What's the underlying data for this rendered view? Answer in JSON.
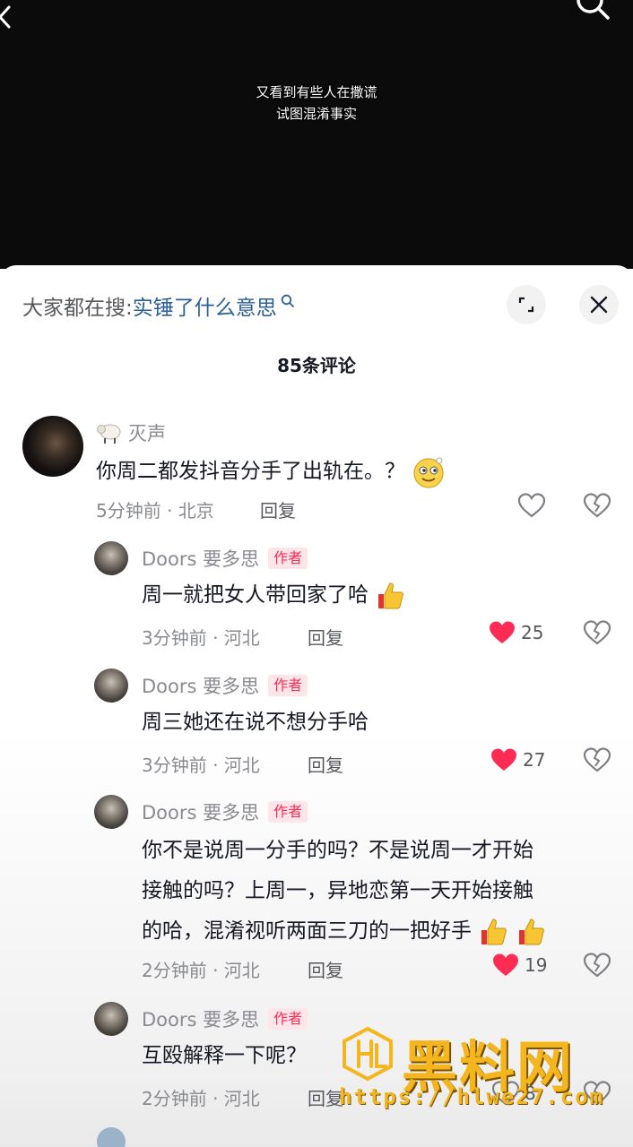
{
  "video": {
    "subtitle_line1": "又看到有些人在撒谎",
    "subtitle_line2": "试图混淆事实"
  },
  "search_bar": {
    "prefix": "大家都在搜:",
    "term": "实锤了什么意思"
  },
  "comment_count": "85条评论",
  "colors": {
    "like_red": "#fe2c55",
    "author_tag_text": "#fe2c55",
    "search_term": "#2b5f99",
    "watermark_gold": "#f5b51c"
  },
  "comments": [
    {
      "username": "灭声",
      "text": "你周二都发抖音分手了出轨在。？",
      "time_location": "5分钟前 · 北京",
      "reply_label": "回复",
      "liked": false,
      "like_count": ""
    },
    {
      "username": "Doors 要多思",
      "author_tag": "作者",
      "text": "周一就把女人带回家了哈",
      "time_location": "3分钟前 · 河北",
      "reply_label": "回复",
      "liked": true,
      "like_count": "25"
    },
    {
      "username": "Doors 要多思",
      "author_tag": "作者",
      "text": "周三她还在说不想分手哈",
      "time_location": "3分钟前 · 河北",
      "reply_label": "回复",
      "liked": true,
      "like_count": "27"
    },
    {
      "username": "Doors 要多思",
      "author_tag": "作者",
      "text_line1": "你不是说周一分手的吗？不是说周一才开始",
      "text_line2": "接触的吗？上周一，异地恋第一天开始接触",
      "text_line3": "的哈，混淆视听两面三刀的一把好手",
      "time_location": "2分钟前 · 河北",
      "reply_label": "回复",
      "liked": true,
      "like_count": "19"
    },
    {
      "username": "Doors 要多思",
      "author_tag": "作者",
      "text": "互殴解释一下呢？",
      "time_location": "2分钟前 · 河北",
      "reply_label": "回复",
      "liked": false,
      "like_count": "8"
    }
  ],
  "watermark": {
    "brand": "黑料网",
    "url": "https://hlwe27.com"
  },
  "icons": {
    "back": "back-arrow-icon",
    "search": "search-icon",
    "expand": "expand-icon",
    "close": "close-icon",
    "like": "heart-icon",
    "dislike": "broken-heart-icon",
    "sheep": "sheep-emoji-icon",
    "thumbs": "thumbs-up-emoji-icon",
    "smile": "smile-emoji-icon"
  }
}
